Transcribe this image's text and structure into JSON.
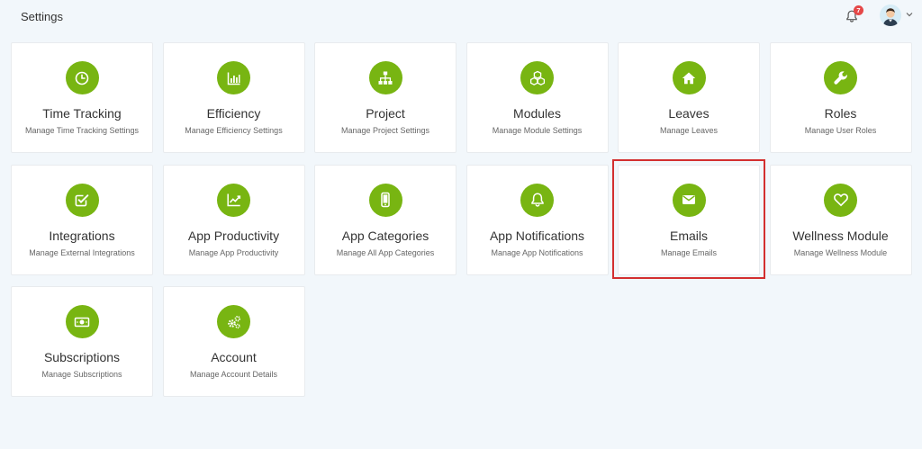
{
  "header": {
    "title": "Settings",
    "notification_count": "7",
    "icons": {
      "notifications": "bell-icon",
      "profile": "avatar",
      "menu": "chevron-down-icon"
    }
  },
  "accent_color": "#78b512",
  "highlight_color": "#d32f2f",
  "cards": [
    {
      "title": "Time Tracking",
      "subtitle": "Manage Time Tracking Settings",
      "icon": "clock-icon"
    },
    {
      "title": "Efficiency",
      "subtitle": "Manage Efficiency Settings",
      "icon": "bar-chart-icon"
    },
    {
      "title": "Project",
      "subtitle": "Manage Project Settings",
      "icon": "hierarchy-icon"
    },
    {
      "title": "Modules",
      "subtitle": "Manage Module Settings",
      "icon": "cubes-icon"
    },
    {
      "title": "Leaves",
      "subtitle": "Manage Leaves",
      "icon": "home-icon"
    },
    {
      "title": "Roles",
      "subtitle": "Manage User Roles",
      "icon": "wrench-icon"
    },
    {
      "title": "Integrations",
      "subtitle": "Manage External Integrations",
      "icon": "checkbox-icon"
    },
    {
      "title": "App Productivity",
      "subtitle": "Manage App Productivity",
      "icon": "trend-chart-icon"
    },
    {
      "title": "App Categories",
      "subtitle": "Manage All App Categories",
      "icon": "mobile-icon"
    },
    {
      "title": "App Notifications",
      "subtitle": "Manage App Notifications",
      "icon": "bell-icon"
    },
    {
      "title": "Emails",
      "subtitle": "Manage Emails",
      "icon": "envelope-icon",
      "highlighted": true
    },
    {
      "title": "Wellness Module",
      "subtitle": "Manage Wellness Module",
      "icon": "heart-icon"
    },
    {
      "title": "Subscriptions",
      "subtitle": "Manage Subscriptions",
      "icon": "money-icon"
    },
    {
      "title": "Account",
      "subtitle": "Manage Account Details",
      "icon": "cogs-icon"
    }
  ]
}
